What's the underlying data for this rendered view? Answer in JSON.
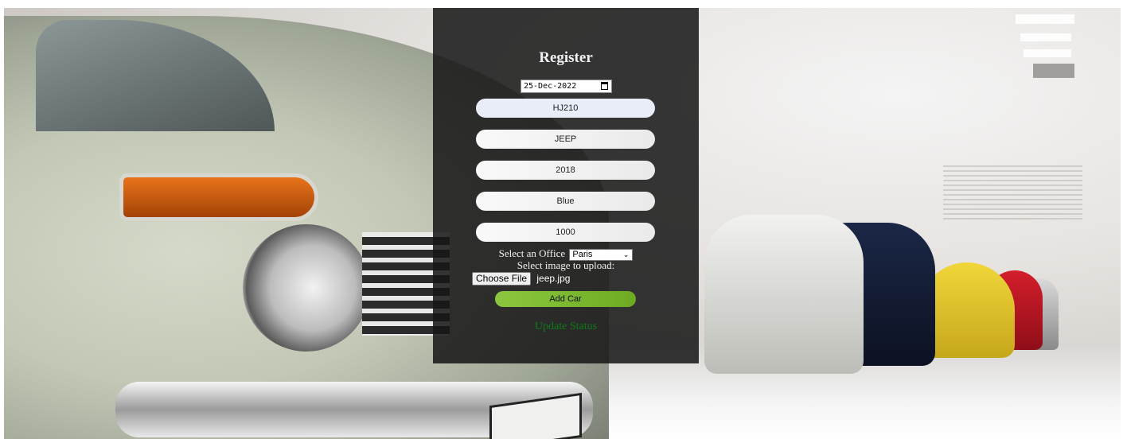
{
  "form": {
    "title": "Register",
    "date_value": "25-Dec-2022",
    "fields": [
      {
        "value": "HJ210"
      },
      {
        "value": "JEEP"
      },
      {
        "value": "2018"
      },
      {
        "value": "Blue"
      },
      {
        "value": "1000"
      }
    ],
    "office_label": "Select an Office",
    "office_selected": "Paris",
    "upload_label": "Select image to upload:",
    "choose_file_label": "Choose File",
    "file_name": "jeep.jpg",
    "submit_label": "Add Car",
    "status_text": "Update Status"
  },
  "colors": {
    "panel": "#161616",
    "button_green": "#8cc63f",
    "status_green": "#0f7a1b"
  },
  "icons": {
    "calendar": "calendar-icon",
    "dropdown": "chevron-down-icon"
  }
}
